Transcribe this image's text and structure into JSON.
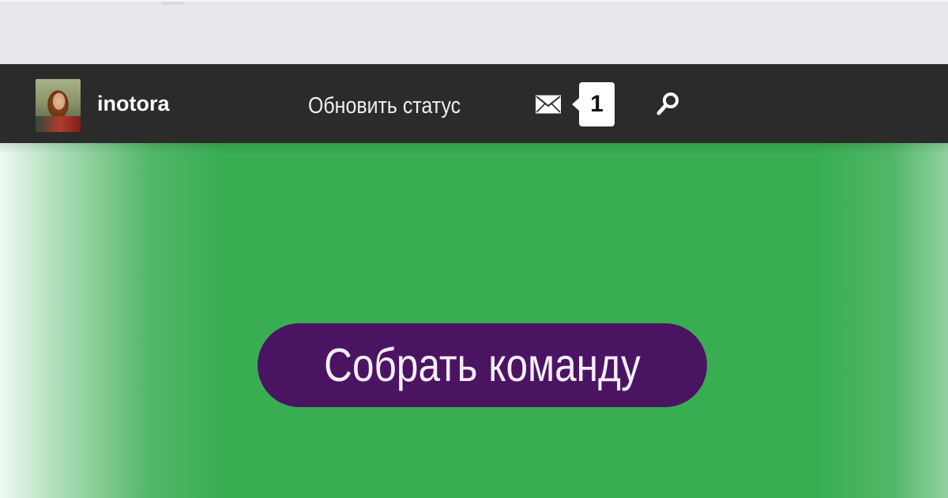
{
  "navbar": {
    "username": "inotora",
    "update_status_label": "Обновить статус",
    "messages_count": "1",
    "icons": {
      "avatar": "user-avatar",
      "messages": "envelope-icon",
      "search": "search-icon"
    },
    "background_color": "#2b2b2b"
  },
  "hero": {
    "cta_label": "Собрать команду",
    "background_color": "#38ad52",
    "button_color": "#4b1462"
  }
}
